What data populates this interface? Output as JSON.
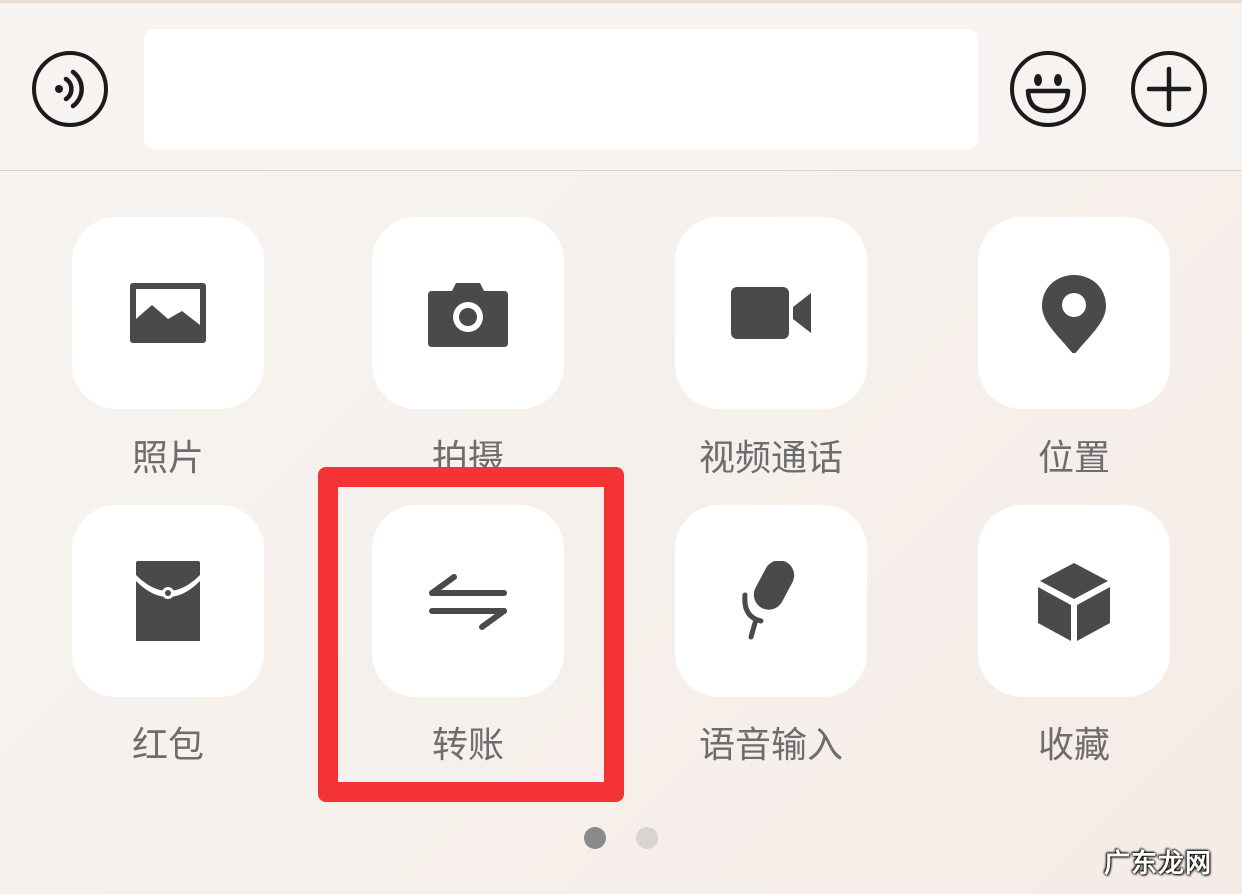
{
  "input_bar": {
    "voice_icon": "voice-icon",
    "message_value": "",
    "emoji_icon": "emoji-icon",
    "plus_icon": "plus-icon"
  },
  "panel": {
    "items": [
      {
        "label": "照片",
        "icon": "photo-icon"
      },
      {
        "label": "拍摄",
        "icon": "camera-icon"
      },
      {
        "label": "视频通话",
        "icon": "video-call-icon"
      },
      {
        "label": "位置",
        "icon": "location-icon"
      },
      {
        "label": "红包",
        "icon": "red-packet-icon"
      },
      {
        "label": "转账",
        "icon": "transfer-icon"
      },
      {
        "label": "语音输入",
        "icon": "voice-input-icon"
      },
      {
        "label": "收藏",
        "icon": "favorites-icon"
      }
    ]
  },
  "pager": {
    "pages": 2,
    "current": 1
  },
  "colors": {
    "icon": "#4a4a4a",
    "highlight": "#f43434",
    "dot_active": "#8a8a8a",
    "dot_inactive": "#d8d4d2"
  },
  "watermark": "广东龙网"
}
